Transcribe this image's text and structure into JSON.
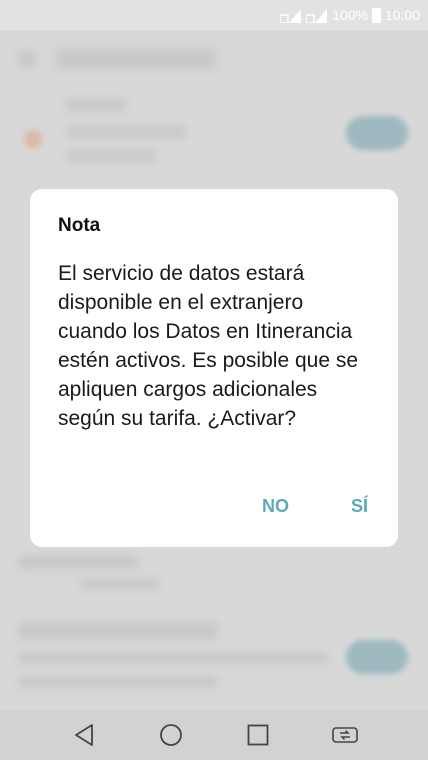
{
  "status_bar": {
    "battery_percent": "100%",
    "time": "10:00",
    "icons": [
      "signal-1-icon",
      "signal-2-icon",
      "battery-icon"
    ]
  },
  "dialog": {
    "title": "Nota",
    "message": "El servicio de datos estará disponible en el extranjero cuando los Datos en Itinerancia estén activos. Es posible que se apliquen cargos adicionales según su tarifa. ¿Activar?",
    "cancel_label": "NO",
    "confirm_label": "SÍ",
    "accent_color": "#5aaab9"
  },
  "nav_bar": {
    "icons": [
      "back-icon",
      "home-icon",
      "recents-icon",
      "dual-window-icon"
    ]
  }
}
